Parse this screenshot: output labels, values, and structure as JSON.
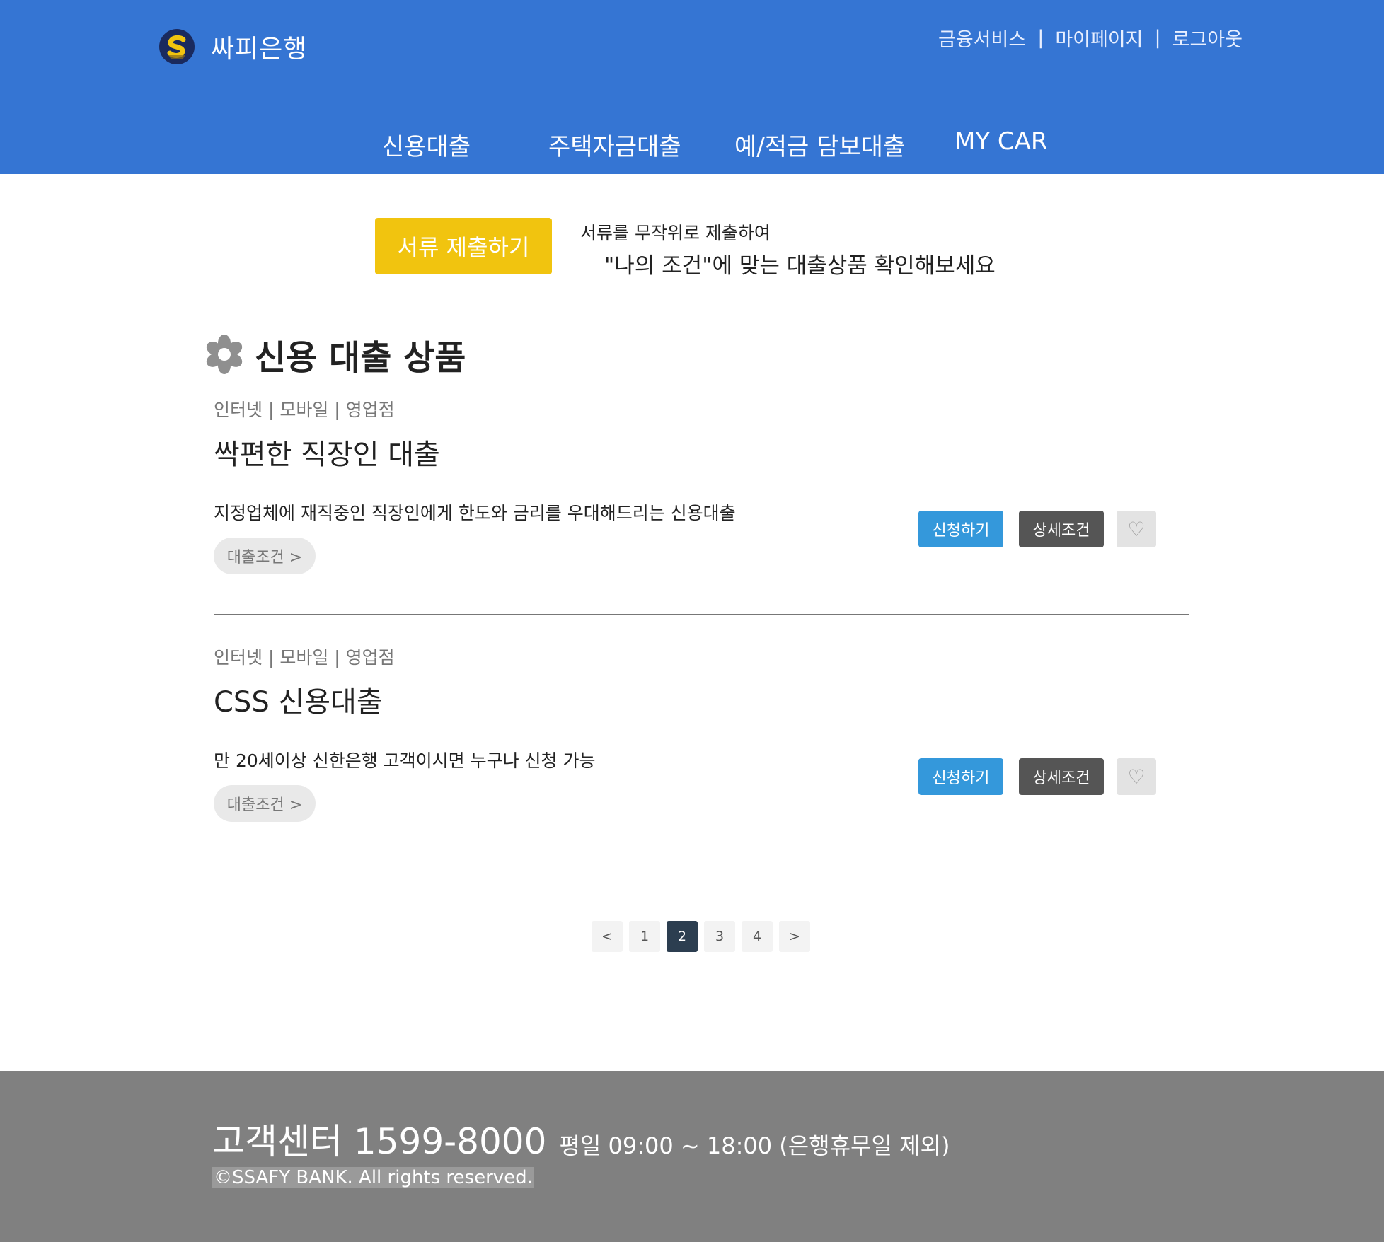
{
  "brand": {
    "name": "싸피은행",
    "logo_icon": "ssafy-bank-logo-icon",
    "logo_colors": {
      "circle": "#1a2a5e",
      "letter": "#f1c40f"
    }
  },
  "util_nav": {
    "items": [
      "금융서비스",
      "마이페이지",
      "로그아웃"
    ],
    "separator": "|"
  },
  "main_nav": {
    "items": [
      "신용대출",
      "주택자금대출",
      "예/적금 담보대출",
      "MY CAR"
    ]
  },
  "promo": {
    "button_label": "서류 제출하기",
    "line1": "서류를 무작위로 제출하여",
    "line2": "\"나의 조건\"에 맞는 대출상품 확인해보세요"
  },
  "section": {
    "title": "신용 대출 상품",
    "icon": "flower-icon"
  },
  "products": [
    {
      "channels": "인터넷 | 모바일 | 영업점",
      "name": "싹편한 직장인 대출",
      "description": "지정업체에 재직중인 직장인에게 한도와 금리를 우대해드리는 신용대출",
      "condition_label": "대출조건 >",
      "apply_label": "신청하기",
      "detail_label": "상세조건",
      "like_icon": "♡"
    },
    {
      "channels": "인터넷 | 모바일 | 영업점",
      "name": "CSS 신용대출",
      "description": "만 20세이상 신한은행 고객이시면 누구나 신청 가능",
      "condition_label": "대출조건 >",
      "apply_label": "신청하기",
      "detail_label": "상세조건",
      "like_icon": "♡"
    }
  ],
  "pagination": {
    "prev": "<",
    "next": ">",
    "pages": [
      "1",
      "2",
      "3",
      "4"
    ],
    "current": "2"
  },
  "footer": {
    "center_label": "고객센터 1599-8000",
    "hours": "평일 09:00 ~ 18:00 (은행휴무일 제외)",
    "copyright": "©SSAFY BANK. All rights reserved."
  },
  "colors": {
    "header_bg": "#3575d3",
    "promo_button": "#f1c40f",
    "apply_button": "#3498db",
    "detail_button": "#555555",
    "active_page": "#2c3e50",
    "footer_bg": "#808080"
  }
}
